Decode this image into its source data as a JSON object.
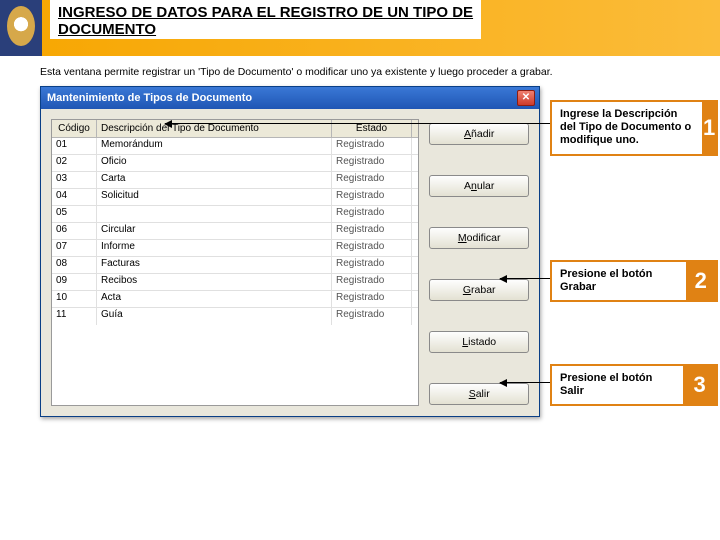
{
  "header": {
    "title_line1": "INGRESO DE DATOS PARA EL REGISTRO DE UN TIPO DE",
    "title_line2": "DOCUMENTO"
  },
  "intro": "Esta ventana permite registrar un 'Tipo de Documento' o modificar uno ya existente y luego proceder a grabar.",
  "dialog": {
    "title": "Mantenimiento de Tipos de Documento",
    "close_glyph": "✕"
  },
  "grid": {
    "headers": {
      "codigo": "Código",
      "desc": "Descripción del Tipo de Documento",
      "estado": "Estado"
    },
    "rows": [
      {
        "codigo": "01",
        "desc": "Memorándum",
        "estado": "Registrado"
      },
      {
        "codigo": "02",
        "desc": "Oficio",
        "estado": "Registrado"
      },
      {
        "codigo": "03",
        "desc": "Carta",
        "estado": "Registrado"
      },
      {
        "codigo": "04",
        "desc": "Solicitud",
        "estado": "Registrado"
      },
      {
        "codigo": "05",
        "desc": "",
        "estado": "Registrado"
      },
      {
        "codigo": "06",
        "desc": "Circular",
        "estado": "Registrado"
      },
      {
        "codigo": "07",
        "desc": "Informe",
        "estado": "Registrado"
      },
      {
        "codigo": "08",
        "desc": "Facturas",
        "estado": "Registrado"
      },
      {
        "codigo": "09",
        "desc": "Recibos",
        "estado": "Registrado"
      },
      {
        "codigo": "10",
        "desc": "Acta",
        "estado": "Registrado"
      },
      {
        "codigo": "11",
        "desc": "Guía",
        "estado": "Registrado"
      }
    ]
  },
  "buttons": {
    "adicionar": "Añadir",
    "anular": "Anular",
    "modificar": "Modificar",
    "grabar": "Grabar",
    "listado": "Listado",
    "salir": "Salir"
  },
  "callouts": {
    "c1": {
      "text": "Ingrese la Descripción del Tipo de Documento o modifique uno.",
      "num": "1"
    },
    "c2": {
      "text": "Presione el botón Grabar",
      "num": "2"
    },
    "c3": {
      "text": "Presione el botón Salir",
      "num": "3"
    }
  }
}
